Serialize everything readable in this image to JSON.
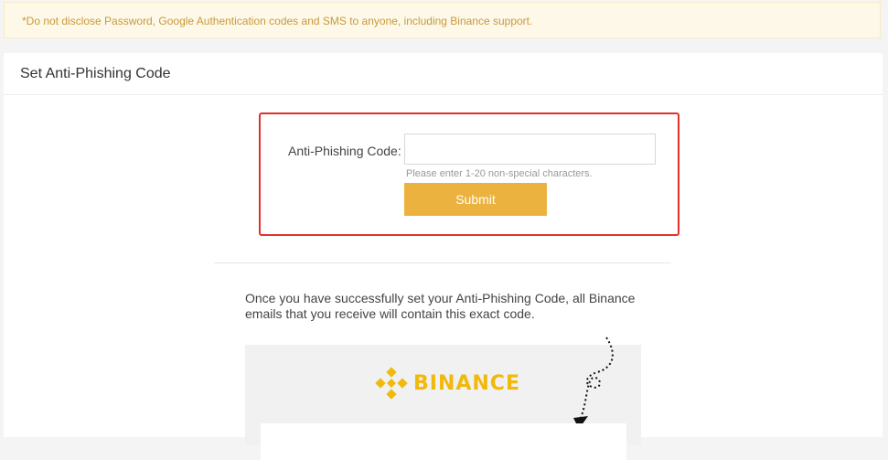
{
  "warning": {
    "text": "*Do not disclose Password, Google Authentication codes and SMS to anyone, including Binance support."
  },
  "card": {
    "title": "Set Anti-Phishing Code"
  },
  "form": {
    "label": "Anti-Phishing Code:",
    "input_value": "",
    "input_placeholder": "",
    "hint": "Please enter 1-20 non-special characters.",
    "submit_label": "Submit"
  },
  "info": {
    "text": "Once you have successfully set your Anti-Phishing Code, all Binance emails that you receive will contain this exact code."
  },
  "preview": {
    "brand_name": "BINANCE"
  },
  "colors": {
    "warning_text": "#c99a3b",
    "warning_bg": "#fdf8e8",
    "highlight_border": "#e0312b",
    "submit_bg": "#ebb23f",
    "brand": "#f0b90b"
  },
  "icons": {
    "brand_logo": "binance-logo-icon",
    "arrow": "dotted-arrow-icon"
  }
}
